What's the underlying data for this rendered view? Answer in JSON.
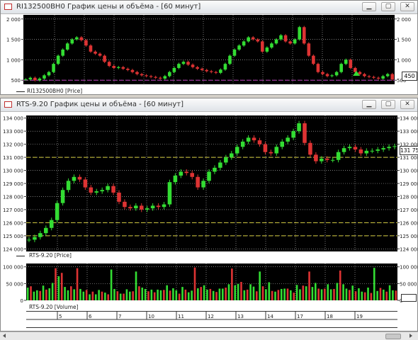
{
  "window1": {
    "title": "RI132500BH0 График цены и объёма - [60 минут]",
    "legend": "RI132500BH0 [Price]",
    "price_label": "450",
    "yticks": [
      "2 000",
      "1 500",
      "1 000",
      "500"
    ],
    "buttons": {
      "minimize": "▁",
      "maximize": "▢",
      "close": "✕"
    }
  },
  "window2": {
    "title": "RTS-9.20 График цены и объёма - [60 минут]",
    "price_legend": "RTS-9.20 [Price]",
    "volume_legend": "RTS-9.20 [Volume]",
    "price_label": "131 75",
    "yticks": [
      "134 000",
      "133 000",
      "132 000",
      "131 000",
      "130 000",
      "129 000",
      "128 000",
      "127 000",
      "126 000",
      "125 000",
      "124 000"
    ],
    "vol_ticks": [
      "100 000",
      "50 000",
      "0"
    ],
    "dates": [
      "5",
      "6",
      "7",
      "10",
      "11",
      "12",
      "13",
      "14",
      "17",
      "18",
      "19"
    ],
    "buttons": {
      "minimize": "▁",
      "maximize": "▢",
      "close": "✕"
    }
  },
  "colors": {
    "background": "#000000",
    "up": "#33dd33",
    "down": "#dd3333",
    "grid": "#c8c8c8",
    "level_line": "#d8d040",
    "marker_line": "#c040c0"
  },
  "chart_data": [
    {
      "type": "line",
      "series": [
        {
          "values": [
            520,
            560,
            500,
            540,
            620,
            700,
            900,
            1100,
            1250,
            1400,
            1500,
            1550,
            1480,
            1350,
            1200,
            1150,
            1100,
            950,
            850,
            800,
            820,
            780,
            750,
            700,
            650,
            620,
            600,
            580,
            560,
            540,
            600,
            700,
            800,
            900,
            950,
            880,
            820,
            780,
            750,
            720,
            700,
            680,
            760,
            900,
            1100,
            1250,
            1350,
            1450,
            1550,
            1500,
            1450,
            1200,
            1300,
            1400,
            1500,
            1600,
            1450,
            1400,
            1500,
            1800,
            1400,
            1100,
            900,
            700,
            650,
            600,
            620,
            700,
            900,
            1000,
            800,
            700,
            650,
            600,
            580,
            560,
            540,
            600,
            650,
            520
          ]
        }
      ],
      "ylim": [
        400,
        2100
      ],
      "ticks": [
        2000,
        1500,
        1000,
        500
      ],
      "level": 500
    },
    {
      "type": "line",
      "series": [
        {
          "values": [
            124700,
            124900,
            125200,
            125600,
            126200,
            127500,
            128500,
            129200,
            129500,
            129300,
            128700,
            128300,
            128400,
            128500,
            128800,
            128300,
            127600,
            127200,
            127100,
            127300,
            127000,
            127100,
            127300,
            127200,
            127400,
            129100,
            129600,
            129900,
            129800,
            129500,
            128700,
            129200,
            129900,
            130200,
            130600,
            131000,
            131300,
            131800,
            132200,
            132500,
            132300,
            132000,
            131400,
            131300,
            131800,
            132200,
            132500,
            133000,
            133600,
            132100,
            131200,
            130700,
            130900,
            130800,
            130800,
            131400,
            131700,
            131800,
            131600,
            131300,
            131500,
            131500,
            131600,
            131700,
            131800,
            131850
          ]
        }
      ],
      "ylim": [
        123800,
        134200
      ],
      "ticks": [
        134000,
        133000,
        132000,
        131000,
        130000,
        129000,
        128000,
        127000,
        126000,
        125000,
        124000
      ],
      "levels": [
        131000,
        126000,
        125000
      ]
    },
    {
      "type": "bar",
      "series": [
        {
          "values": [
            38000,
            42000,
            26000,
            30000,
            28000,
            44000,
            32000,
            36000,
            52000,
            96000,
            72000,
            82000,
            40000,
            30000,
            42000,
            33000,
            96000,
            34000,
            26000,
            31000,
            18000,
            26000,
            18000,
            31000,
            26000,
            23000,
            18000,
            92000,
            34000,
            27000,
            20000,
            20000,
            33000,
            26000,
            27000,
            86000,
            42000,
            38000,
            34000,
            27000,
            32000,
            24000,
            32000,
            30000,
            31000,
            45000,
            29000,
            36000,
            30000,
            20000,
            40000,
            32000,
            24000,
            29000,
            98000,
            36000,
            40000,
            45000,
            32000,
            34000,
            28000,
            25000,
            35000,
            35000,
            38000,
            48000,
            95000,
            45000,
            49000,
            55000,
            30000,
            32000,
            48000,
            41000,
            27000,
            86000,
            42000,
            33000,
            54000,
            28000,
            26000,
            31000,
            34000,
            35000,
            35000,
            30000,
            23000,
            46000,
            33000,
            44000,
            42000,
            86000,
            40000,
            52000,
            35000,
            33000,
            35000,
            48000,
            33000,
            34000,
            52000,
            89000,
            48000,
            35000,
            31000,
            44000,
            27000,
            36000,
            26000,
            24000,
            38000,
            22000,
            97000,
            28000,
            37000,
            32000,
            26000,
            45000,
            30000,
            29000
          ]
        }
      ],
      "ylim": [
        0,
        110000
      ],
      "ticks": [
        100000,
        50000,
        0
      ]
    }
  ]
}
